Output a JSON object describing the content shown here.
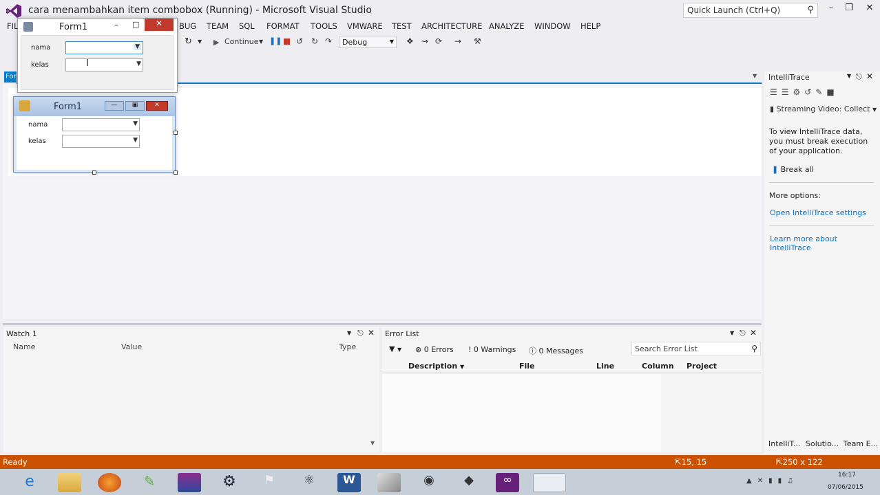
{
  "window": {
    "title": "cara menambahkan item combobox (Running) - Microsoft Visual Studio",
    "quick_launch": "Quick Launch (Ctrl+Q)"
  },
  "menu": [
    "FILE",
    "BUG",
    "TEAM",
    "SQL",
    "FORMAT",
    "TOOLS",
    "VMWARE",
    "TEST",
    "ARCHITECTURE",
    "ANALYZE",
    "WINDOW",
    "HELP"
  ],
  "menu_first": "FIL",
  "toolbar": {
    "continue": "Continue",
    "config": "Debug"
  },
  "doc_tab": "For",
  "running_form": {
    "title": "Form1",
    "nama_label": "nama",
    "kelas_label": "kelas"
  },
  "design_form": {
    "title": "Form1",
    "nama_label": "nama",
    "kelas_label": "kelas"
  },
  "intellitrace": {
    "title": "IntelliTrace",
    "streaming": "Streaming Video: Collect",
    "message": "To view IntelliTrace data, you must break execution of your application.",
    "break_all": "Break all",
    "more_options": "More options:",
    "open_settings": "Open IntelliTrace settings",
    "learn_more": "Learn more about IntelliTrace"
  },
  "watch": {
    "title": "Watch 1",
    "columns": [
      "Name",
      "Value",
      "Type"
    ]
  },
  "error_list": {
    "title": "Error List",
    "errors": "0 Errors",
    "warnings": "0 Warnings",
    "messages": "0 Messages",
    "search_placeholder": "Search Error List",
    "columns": [
      "Description",
      "File",
      "Line",
      "Column",
      "Project"
    ]
  },
  "side_tabs": [
    "IntelliT...",
    "Solutio...",
    "Team E..."
  ],
  "status": {
    "text": "Ready",
    "position": "15, 15",
    "size": "250 x 122"
  },
  "clock": {
    "time": "16:17",
    "date": "07/06/2015"
  },
  "colors": {
    "accent": "#007acc",
    "status_running": "#ca5100",
    "close_red": "#c1392b"
  }
}
